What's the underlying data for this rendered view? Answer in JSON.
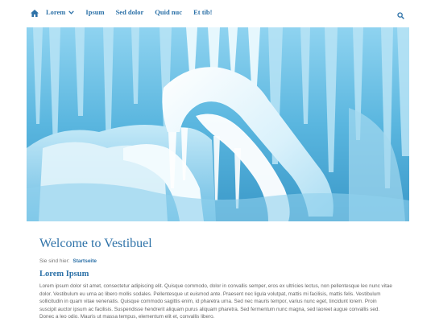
{
  "nav": {
    "home_icon": "home-icon",
    "items": [
      {
        "label": "Lorem",
        "has_dropdown": true
      },
      {
        "label": "Ipsum"
      },
      {
        "label": "Sed dolor"
      },
      {
        "label": "Quid nuc"
      },
      {
        "label": "Et tib!"
      }
    ],
    "search_icon": "search-icon",
    "accent_color": "#2e72a8"
  },
  "hero": {
    "description": "icicles-photo",
    "dominant_color": "#6ec3e6"
  },
  "page": {
    "title": "Welcome to Vestibuel",
    "breadcrumb_prefix": "Sie sind hier:",
    "breadcrumb_link": "Startseite",
    "subtitle": "Lorem Ipsum",
    "body": "Lorem ipsum dolor sit amet, consectetur adipiscing elit. Quisque commodo, dolor in convallis semper, eros ex ultricies lectus, non pellentesque leo nunc vitae dolor. Vestibulum eu urna ac libero mollis sodales. Pellentesque ut euismod ante. Praesent nec ligula volutpat, mattis mi facilisis, mattis felis. Vestibulum sollicitudin in quam vitae venenatis. Quisque commodo sagittis enim, id pharetra urna. Sed nec mauris tempor, varius nunc eget, tincidunt lorem. Proin suscipit auctor ipsum ac facilisis. Suspendisse hendrerit aliquam purus aliquam pharetra. Sed fermentum nunc magna, sed laoreet augue convallis sed. Donec a leo odio. Mauris ut massa tempus, elementum elit et, convallis libero."
  }
}
